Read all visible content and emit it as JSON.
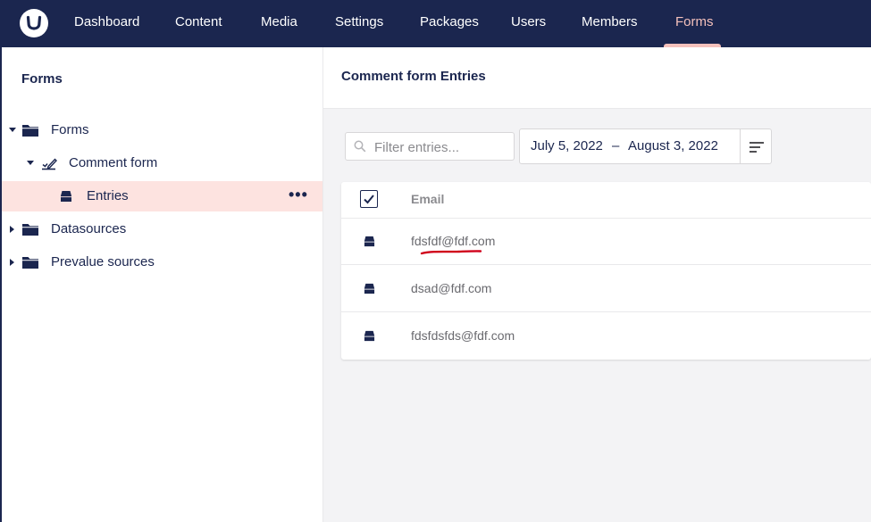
{
  "header": {
    "logo": "umbraco-logo",
    "nav": [
      {
        "label": "Dashboard"
      },
      {
        "label": "Content"
      },
      {
        "label": "Media"
      },
      {
        "label": "Settings"
      },
      {
        "label": "Packages"
      },
      {
        "label": "Users"
      },
      {
        "label": "Members"
      },
      {
        "label": "Forms",
        "active": true
      }
    ],
    "active_color": "#f5c1bc"
  },
  "tree": {
    "title": "Forms",
    "items": [
      {
        "label": "Forms",
        "icon": "folder-icon",
        "expanded": true
      },
      {
        "label": "Comment form",
        "icon": "form-edit-icon",
        "expanded": true
      },
      {
        "label": "Entries",
        "icon": "inbox-icon",
        "selected": true,
        "actions": "•••"
      },
      {
        "label": "Datasources",
        "icon": "folder-icon",
        "expanded": false
      },
      {
        "label": "Prevalue sources",
        "icon": "folder-icon",
        "expanded": false
      }
    ]
  },
  "main": {
    "title": "Comment form Entries",
    "filter_placeholder": "Filter entries...",
    "date_from": "July 5, 2022",
    "date_separator": "–",
    "date_to": "August 3, 2022",
    "table": {
      "column": "Email",
      "rows": [
        {
          "email": "fdsfdf@fdf.com"
        },
        {
          "email": "dsad@fdf.com"
        },
        {
          "email": "fdsfdsfds@fdf.com"
        }
      ]
    }
  },
  "colors": {
    "navy": "#1b264f",
    "selected_row": "#fde3e0",
    "annotation": "#d0021b"
  }
}
